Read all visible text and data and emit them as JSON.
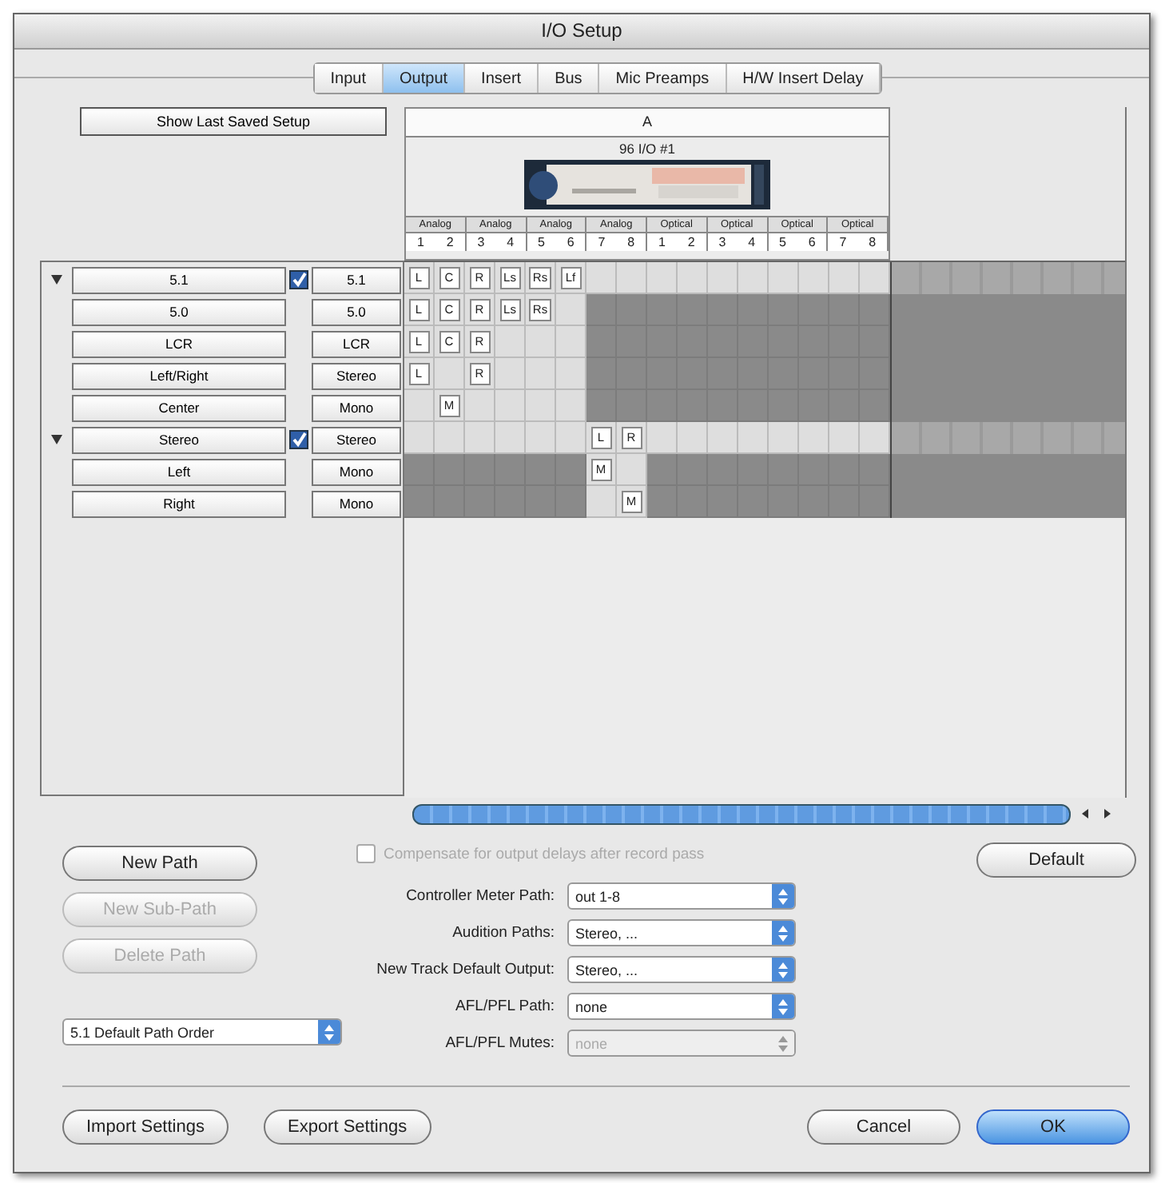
{
  "window": {
    "title": "I/O Setup"
  },
  "tabs": [
    {
      "label": "Input",
      "selected": false
    },
    {
      "label": "Output",
      "selected": true
    },
    {
      "label": "Insert",
      "selected": false
    },
    {
      "label": "Bus",
      "selected": false
    },
    {
      "label": "Mic Preamps",
      "selected": false
    },
    {
      "label": "H/W Insert Delay",
      "selected": false
    }
  ],
  "show_last_saved_button": "Show Last Saved Setup",
  "interface": {
    "group": "A",
    "device": "96 I/O #1",
    "kind": "picture",
    "channel_groups": [
      {
        "name": "Analog",
        "channels": [
          "1",
          "2"
        ]
      },
      {
        "name": "Analog",
        "channels": [
          "3",
          "4"
        ]
      },
      {
        "name": "Analog",
        "channels": [
          "5",
          "6"
        ]
      },
      {
        "name": "Analog",
        "channels": [
          "7",
          "8"
        ]
      },
      {
        "name": "Optical",
        "channels": [
          "1",
          "2"
        ]
      },
      {
        "name": "Optical",
        "channels": [
          "3",
          "4"
        ]
      },
      {
        "name": "Optical",
        "channels": [
          "5",
          "6"
        ]
      },
      {
        "name": "Optical",
        "channels": [
          "7",
          "8"
        ]
      }
    ]
  },
  "paths": [
    {
      "name": "5.1",
      "format": "5.1",
      "checked": true,
      "expanded": true,
      "cells": [
        {
          "available": true,
          "label": "L"
        },
        {
          "available": true,
          "label": "C"
        },
        {
          "available": true,
          "label": "R"
        },
        {
          "available": true,
          "label": "Ls"
        },
        {
          "available": true,
          "label": "Rs"
        },
        {
          "available": true,
          "label": "Lf"
        },
        {
          "available": true
        },
        {
          "available": true
        },
        {
          "available": true
        },
        {
          "available": true
        },
        {
          "available": true
        },
        {
          "available": true
        },
        {
          "available": true
        },
        {
          "available": true
        },
        {
          "available": true
        },
        {
          "available": true
        }
      ],
      "children": [
        {
          "name": "5.0",
          "format": "5.0",
          "cells": [
            {
              "available": true,
              "label": "L"
            },
            {
              "available": true,
              "label": "C"
            },
            {
              "available": true,
              "label": "R"
            },
            {
              "available": true,
              "label": "Ls"
            },
            {
              "available": true,
              "label": "Rs"
            },
            {
              "available": true
            },
            {
              "available": false
            },
            {
              "available": false
            },
            {
              "available": false
            },
            {
              "available": false
            },
            {
              "available": false
            },
            {
              "available": false
            },
            {
              "available": false
            },
            {
              "available": false
            },
            {
              "available": false
            },
            {
              "available": false
            }
          ]
        },
        {
          "name": "LCR",
          "format": "LCR",
          "cells": [
            {
              "available": true,
              "label": "L"
            },
            {
              "available": true,
              "label": "C"
            },
            {
              "available": true,
              "label": "R"
            },
            {
              "available": true
            },
            {
              "available": true
            },
            {
              "available": true
            },
            {
              "available": false
            },
            {
              "available": false
            },
            {
              "available": false
            },
            {
              "available": false
            },
            {
              "available": false
            },
            {
              "available": false
            },
            {
              "available": false
            },
            {
              "available": false
            },
            {
              "available": false
            },
            {
              "available": false
            }
          ]
        },
        {
          "name": "Left/Right",
          "format": "Stereo",
          "cells": [
            {
              "available": true,
              "label": "L"
            },
            {
              "available": true
            },
            {
              "available": true,
              "label": "R"
            },
            {
              "available": true
            },
            {
              "available": true
            },
            {
              "available": true
            },
            {
              "available": false
            },
            {
              "available": false
            },
            {
              "available": false
            },
            {
              "available": false
            },
            {
              "available": false
            },
            {
              "available": false
            },
            {
              "available": false
            },
            {
              "available": false
            },
            {
              "available": false
            },
            {
              "available": false
            }
          ]
        },
        {
          "name": "Center",
          "format": "Mono",
          "cells": [
            {
              "available": true
            },
            {
              "available": true,
              "label": "M"
            },
            {
              "available": true
            },
            {
              "available": true
            },
            {
              "available": true
            },
            {
              "available": true
            },
            {
              "available": false
            },
            {
              "available": false
            },
            {
              "available": false
            },
            {
              "available": false
            },
            {
              "available": false
            },
            {
              "available": false
            },
            {
              "available": false
            },
            {
              "available": false
            },
            {
              "available": false
            },
            {
              "available": false
            }
          ]
        }
      ]
    },
    {
      "name": "Stereo",
      "format": "Stereo",
      "checked": true,
      "expanded": true,
      "cells": [
        {
          "available": true
        },
        {
          "available": true
        },
        {
          "available": true
        },
        {
          "available": true
        },
        {
          "available": true
        },
        {
          "available": true
        },
        {
          "available": true,
          "label": "L"
        },
        {
          "available": true,
          "label": "R"
        },
        {
          "available": true
        },
        {
          "available": true
        },
        {
          "available": true
        },
        {
          "available": true
        },
        {
          "available": true
        },
        {
          "available": true
        },
        {
          "available": true
        },
        {
          "available": true
        }
      ],
      "children": [
        {
          "name": "Left",
          "format": "Mono",
          "cells": [
            {
              "available": false
            },
            {
              "available": false
            },
            {
              "available": false
            },
            {
              "available": false
            },
            {
              "available": false
            },
            {
              "available": false
            },
            {
              "available": true,
              "label": "M"
            },
            {
              "available": true
            },
            {
              "available": false
            },
            {
              "available": false
            },
            {
              "available": false
            },
            {
              "available": false
            },
            {
              "available": false
            },
            {
              "available": false
            },
            {
              "available": false
            },
            {
              "available": false
            }
          ]
        },
        {
          "name": "Right",
          "format": "Mono",
          "cells": [
            {
              "available": false
            },
            {
              "available": false
            },
            {
              "available": false
            },
            {
              "available": false
            },
            {
              "available": false
            },
            {
              "available": false
            },
            {
              "available": true
            },
            {
              "available": true,
              "label": "M"
            },
            {
              "available": false
            },
            {
              "available": false
            },
            {
              "available": false
            },
            {
              "available": false
            },
            {
              "available": false
            },
            {
              "available": false
            },
            {
              "available": false
            },
            {
              "available": false
            }
          ]
        }
      ]
    }
  ],
  "path_buttons": [
    {
      "label": "New Path",
      "disabled": false
    },
    {
      "label": "New Sub-Path",
      "disabled": true
    },
    {
      "label": "Delete Path",
      "disabled": true
    }
  ],
  "path_order_select": {
    "value": "5.1 Default Path Order",
    "disabled": false
  },
  "compensate_checkbox": {
    "label": "Compensate for output delays after record pass",
    "checked": false,
    "disabled": true
  },
  "default_button": "Default",
  "settings": [
    {
      "label": "Controller Meter Path:",
      "value": "out 1-8",
      "disabled": false
    },
    {
      "label": "Audition Paths:",
      "value": "Stereo, ...",
      "disabled": false
    },
    {
      "label": "New Track Default Output:",
      "value": "Stereo, ...",
      "disabled": false
    },
    {
      "label": "AFL/PFL Path:",
      "value": "none",
      "disabled": false
    },
    {
      "label": "AFL/PFL Mutes:",
      "value": "none",
      "disabled": true
    }
  ],
  "footer_buttons": [
    {
      "label": "Import Settings",
      "kind": "plain"
    },
    {
      "label": "Export Settings",
      "kind": "plain"
    },
    {
      "label": "Cancel",
      "kind": "plain"
    },
    {
      "label": "OK",
      "kind": "default"
    }
  ]
}
